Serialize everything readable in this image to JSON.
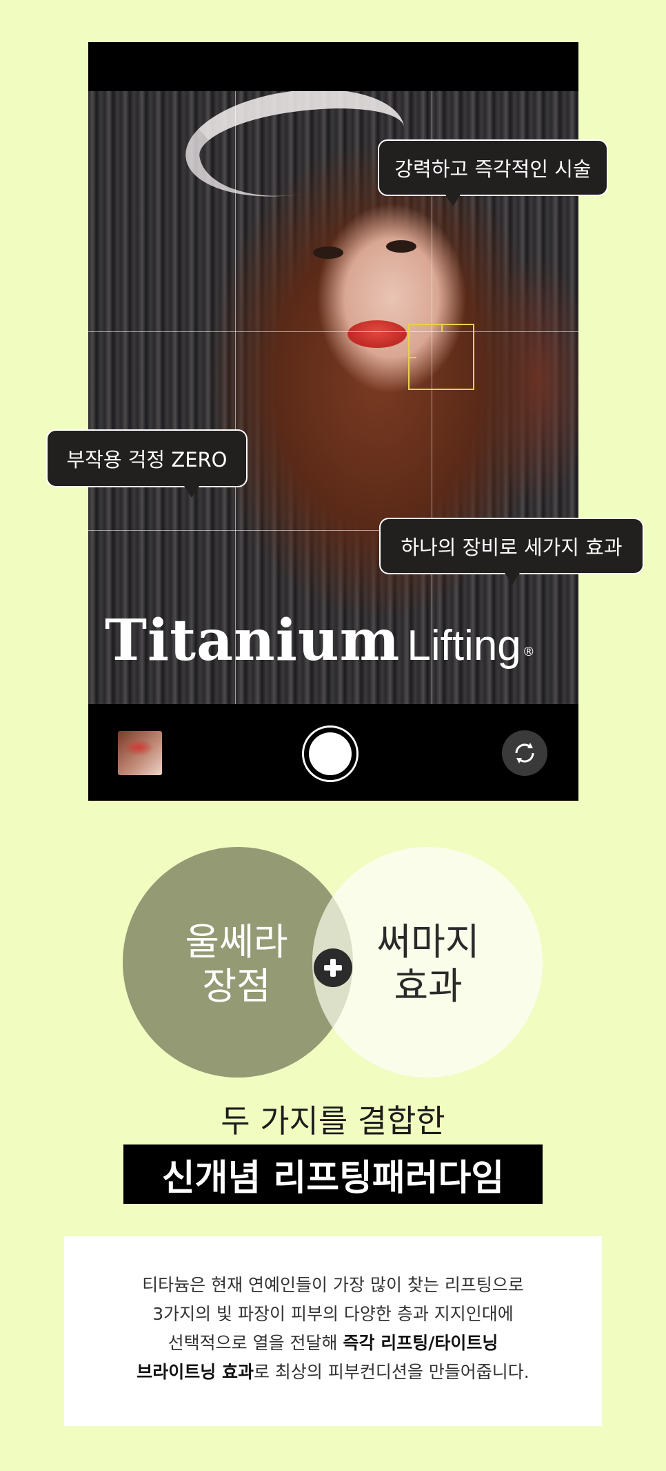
{
  "phone": {
    "photo": {
      "brand_main": "Titanium",
      "brand_sub": "Lifting",
      "brand_mark": "®"
    },
    "bubbles": {
      "top_right": "강력하고 즉각적인 시술",
      "left": "부작용 걱정 ZERO",
      "bottom_right": "하나의 장비로 세가지 효과"
    }
  },
  "venn": {
    "left": [
      "울쎄라",
      "장점"
    ],
    "right": [
      "써마지",
      "효과"
    ],
    "colors": {
      "left": "#949a73",
      "right": "#fafde9",
      "overlap": "#dde0c8"
    }
  },
  "headline": {
    "line1": "두 가지를 결합한",
    "line2": "신개념 리프팅패러다임"
  },
  "description": {
    "line1": "티타늄은 현재 연예인들이 가장 많이 찾는 리프팅으로",
    "line2": "3가지의 빛 파장이 피부의 다양한 층과 지지인대에",
    "line3_pre": "선택적으로 열을 전달해 ",
    "line3_bold": "즉각 리프팅/타이트닝",
    "line4_bold": "브라이트닝 효과",
    "line4_post": "로 최상의 피부컨디션을 만들어줍니다."
  },
  "colors": {
    "background": "#f1fcc1",
    "bubble": "#221f1f",
    "accent_focus": "#e8d24a"
  }
}
